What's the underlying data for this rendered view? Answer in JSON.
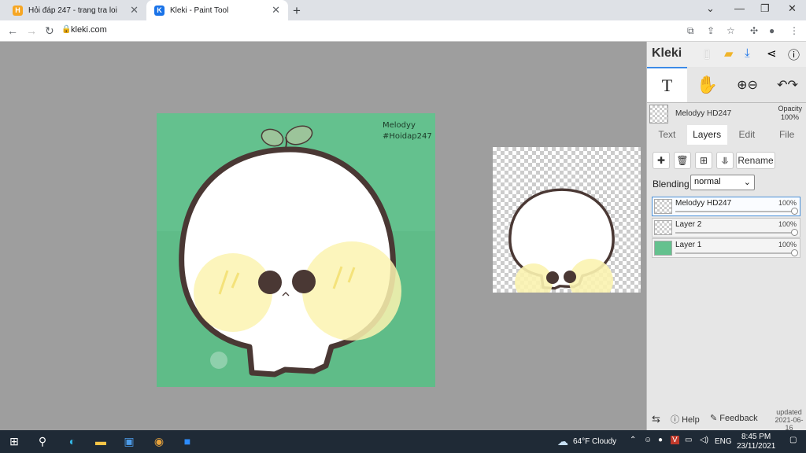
{
  "browser": {
    "tabs": [
      {
        "title": "Hỏi đáp 247 - trang tra loi",
        "favicon": "H",
        "favicon_color": "#f6a623",
        "active": false
      },
      {
        "title": "Kleki - Paint Tool",
        "favicon": "K",
        "favicon_color": "#1a73e8",
        "active": true
      }
    ],
    "url": "kleki.com"
  },
  "canvas": {
    "background_color": "#64c18e",
    "watermark_line1": "Melodyy",
    "watermark_line2": "#Hoidap247"
  },
  "panel": {
    "brand": "Kleki",
    "current_layer_name": "Melodyy HD247",
    "opacity_label": "Opacity",
    "opacity_value": "100%",
    "tabs": [
      "Text",
      "Layers",
      "Edit",
      "File"
    ],
    "rename_label": "Rename",
    "blending_label": "Blending",
    "blending_value": "normal",
    "layers": [
      {
        "name": "Melodyy HD247",
        "opacity": "100%",
        "selected": true
      },
      {
        "name": "Layer 2",
        "opacity": "100%",
        "selected": false
      },
      {
        "name": "Layer 1",
        "opacity": "100%",
        "selected": false
      }
    ],
    "help_label": "Help",
    "feedback_label": "Feedback",
    "updated_label": "updated",
    "updated_date": "2021-06-16"
  },
  "taskbar": {
    "weather": "64°F  Cloudy",
    "lang": "ENG",
    "time": "8:45 PM",
    "date": "23/11/2021"
  }
}
